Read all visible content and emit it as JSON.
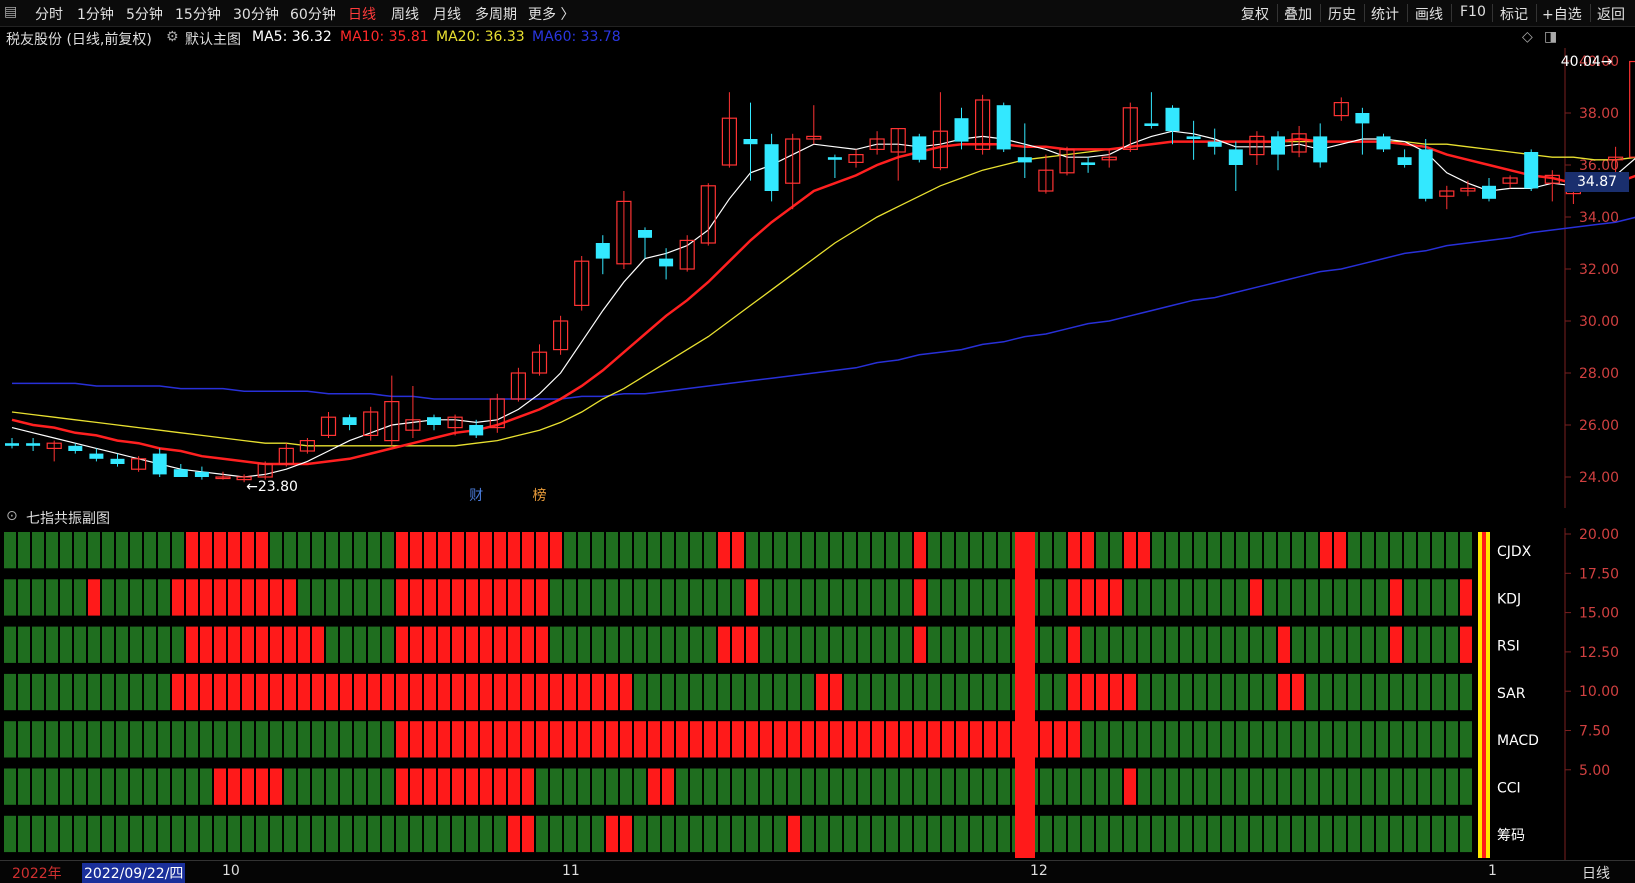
{
  "toolbar": {
    "left_tabs": [
      "分时",
      "1分钟",
      "5分钟",
      "15分钟",
      "30分钟",
      "60分钟",
      "日线",
      "周线",
      "月线",
      "多周期",
      "更多 〉"
    ],
    "active_tab": "日线",
    "right_tabs": [
      "复权",
      "叠加",
      "历史",
      "统计",
      "画线",
      "F10",
      "标记",
      "+自选",
      "返回"
    ]
  },
  "info": {
    "stock": "税友股份 (日线,前复权)",
    "main_chart": "默认主图",
    "ma5": "MA5: 36.32",
    "ma10": "MA10: 35.81",
    "ma20": "MA20: 36.33",
    "ma60": "MA60: 33.78"
  },
  "colors": {
    "up": "#ff3333",
    "down": "#33e8ff",
    "ma5": "#ffffff",
    "ma10": "#ff2020",
    "ma20": "#e8e030",
    "ma60": "#2830d8",
    "resonance_on": "#ff1a1a",
    "resonance_off": "#1f6e1f"
  },
  "price_axis": [
    "40.00",
    "38.00",
    "36.00",
    "34.00",
    "32.00",
    "30.00",
    "28.00",
    "26.00",
    "24.00"
  ],
  "current_price": "34.87",
  "high_label": "40.04",
  "low_label": "←23.80",
  "markers": [
    "财",
    "榜"
  ],
  "sub": {
    "title": "七指共振副图",
    "axis": [
      "20.00",
      "17.50",
      "15.00",
      "12.50",
      "10.00",
      "7.50",
      "5.00"
    ],
    "rows": [
      "CJDX",
      "KDJ",
      "RSI",
      "SAR",
      "MACD",
      "CCI",
      "筹码"
    ]
  },
  "bottom": {
    "year": "2022年",
    "date": "2022/09/22/四",
    "months": [
      "10",
      "11",
      "12",
      "1"
    ],
    "period": "日线"
  },
  "chart_data": {
    "type": "candlestick",
    "ylim": [
      23,
      40.5
    ],
    "ohlc": [
      [
        25.3,
        25.5,
        25.1,
        25.2
      ],
      [
        25.3,
        25.5,
        25.0,
        25.2
      ],
      [
        25.1,
        25.4,
        24.6,
        25.3
      ],
      [
        25.2,
        25.3,
        24.9,
        25.0
      ],
      [
        24.9,
        25.1,
        24.6,
        24.7
      ],
      [
        24.7,
        24.9,
        24.4,
        24.5
      ],
      [
        24.3,
        24.8,
        24.2,
        24.7
      ],
      [
        24.9,
        25.1,
        24.0,
        24.1
      ],
      [
        24.3,
        24.5,
        24.0,
        24.0
      ],
      [
        24.2,
        24.4,
        23.9,
        24.0
      ],
      [
        24.0,
        24.2,
        23.9,
        24.0
      ],
      [
        23.9,
        24.1,
        23.8,
        24.0
      ],
      [
        24.0,
        24.6,
        23.9,
        24.5
      ],
      [
        24.5,
        25.3,
        24.4,
        25.1
      ],
      [
        25.0,
        25.5,
        24.9,
        25.4
      ],
      [
        25.6,
        26.5,
        25.5,
        26.3
      ],
      [
        26.3,
        26.4,
        25.8,
        26.0
      ],
      [
        25.6,
        26.7,
        25.4,
        26.5
      ],
      [
        25.4,
        27.9,
        25.2,
        26.9
      ],
      [
        25.8,
        27.5,
        25.5,
        26.2
      ],
      [
        26.3,
        26.4,
        25.8,
        26.0
      ],
      [
        25.9,
        26.4,
        25.6,
        26.3
      ],
      [
        26.0,
        26.2,
        25.5,
        25.6
      ],
      [
        25.9,
        27.2,
        25.7,
        27.0
      ],
      [
        27.0,
        28.2,
        26.9,
        28.0
      ],
      [
        28.0,
        29.1,
        27.9,
        28.8
      ],
      [
        28.9,
        30.2,
        28.7,
        30.0
      ],
      [
        30.6,
        32.5,
        30.4,
        32.3
      ],
      [
        33.0,
        33.3,
        31.8,
        32.4
      ],
      [
        32.2,
        35.0,
        32.0,
        34.6
      ],
      [
        33.5,
        33.6,
        32.4,
        33.2
      ],
      [
        32.4,
        32.8,
        31.6,
        32.1
      ],
      [
        32.0,
        33.3,
        31.9,
        33.1
      ],
      [
        33.0,
        35.3,
        32.9,
        35.2
      ],
      [
        36.0,
        38.8,
        35.9,
        37.8
      ],
      [
        37.0,
        38.4,
        35.4,
        36.8
      ],
      [
        36.8,
        37.2,
        34.6,
        35.0
      ],
      [
        35.3,
        37.2,
        34.3,
        37.0
      ],
      [
        37.0,
        38.3,
        36.8,
        37.1
      ],
      [
        36.3,
        36.4,
        35.5,
        36.2
      ],
      [
        36.1,
        36.6,
        35.9,
        36.4
      ],
      [
        36.6,
        37.3,
        36.4,
        37.0
      ],
      [
        36.5,
        37.4,
        35.4,
        37.4
      ],
      [
        37.1,
        37.2,
        36.1,
        36.2
      ],
      [
        35.9,
        38.8,
        35.8,
        37.3
      ],
      [
        37.8,
        38.2,
        36.6,
        36.9
      ],
      [
        36.6,
        38.7,
        36.4,
        38.5
      ],
      [
        38.3,
        38.4,
        36.5,
        36.6
      ],
      [
        36.3,
        37.6,
        35.5,
        36.1
      ],
      [
        35.0,
        36.4,
        34.9,
        35.8
      ],
      [
        35.7,
        36.7,
        35.6,
        36.6
      ],
      [
        36.1,
        36.3,
        35.7,
        36.0
      ],
      [
        36.2,
        36.6,
        35.9,
        36.3
      ],
      [
        36.6,
        38.4,
        36.5,
        38.2
      ],
      [
        37.6,
        38.8,
        37.4,
        37.5
      ],
      [
        38.2,
        38.3,
        36.8,
        37.3
      ],
      [
        37.1,
        37.7,
        36.2,
        37.0
      ],
      [
        36.9,
        37.4,
        36.4,
        36.7
      ],
      [
        36.6,
        36.9,
        35.0,
        36.0
      ],
      [
        36.4,
        37.3,
        36.0,
        37.1
      ],
      [
        37.1,
        37.3,
        35.8,
        36.4
      ],
      [
        36.5,
        37.5,
        36.3,
        37.2
      ],
      [
        37.1,
        37.6,
        35.9,
        36.1
      ],
      [
        37.9,
        38.6,
        37.7,
        38.4
      ],
      [
        38.0,
        38.2,
        36.4,
        37.6
      ],
      [
        37.1,
        37.2,
        36.5,
        36.6
      ],
      [
        36.3,
        36.6,
        35.9,
        36.0
      ],
      [
        36.6,
        37.0,
        34.6,
        34.7
      ],
      [
        34.8,
        35.2,
        34.3,
        35.0
      ],
      [
        35.0,
        35.4,
        34.8,
        35.1
      ],
      [
        35.2,
        35.5,
        34.6,
        34.7
      ],
      [
        35.3,
        35.6,
        35.1,
        35.5
      ],
      [
        36.5,
        36.6,
        35.0,
        35.1
      ],
      [
        35.3,
        35.8,
        34.6,
        35.6
      ],
      [
        34.9,
        35.1,
        34.5,
        35.0
      ],
      [
        35.2,
        35.4,
        35.0,
        35.3
      ],
      [
        36.2,
        36.7,
        35.2,
        36.3
      ],
      [
        36.3,
        40.04,
        35.9,
        39.98
      ]
    ],
    "ma5": [
      25.9,
      25.7,
      25.5,
      25.3,
      25.1,
      24.9,
      24.7,
      24.5,
      24.3,
      24.2,
      24.1,
      24.0,
      24.1,
      24.3,
      24.6,
      25.0,
      25.4,
      25.7,
      26.0,
      26.1,
      26.2,
      26.2,
      26.1,
      26.2,
      26.6,
      27.2,
      28.0,
      29.2,
      30.4,
      31.5,
      32.4,
      32.6,
      32.9,
      33.5,
      34.7,
      35.7,
      36.0,
      36.4,
      36.8,
      36.7,
      36.6,
      36.8,
      36.8,
      36.7,
      36.8,
      37.0,
      37.1,
      37.0,
      36.8,
      36.6,
      36.3,
      36.3,
      36.4,
      36.8,
      37.1,
      37.3,
      37.2,
      37.0,
      36.7,
      36.7,
      36.7,
      36.8,
      36.6,
      36.8,
      37.0,
      37.0,
      36.9,
      36.5,
      35.7,
      35.3,
      35.0,
      35.1,
      35.1,
      35.3,
      35.2,
      35.3,
      35.6,
      36.3
    ],
    "ma10": [
      26.2,
      26.0,
      25.9,
      25.7,
      25.6,
      25.4,
      25.3,
      25.1,
      25.0,
      24.8,
      24.7,
      24.6,
      24.5,
      24.5,
      24.5,
      24.6,
      24.7,
      24.9,
      25.1,
      25.3,
      25.5,
      25.7,
      25.8,
      26.0,
      26.3,
      26.6,
      27.0,
      27.5,
      28.1,
      28.8,
      29.5,
      30.2,
      30.8,
      31.5,
      32.3,
      33.1,
      33.8,
      34.4,
      35.0,
      35.3,
      35.6,
      36.0,
      36.3,
      36.5,
      36.7,
      36.8,
      36.8,
      36.8,
      36.7,
      36.7,
      36.6,
      36.6,
      36.6,
      36.7,
      36.8,
      36.9,
      36.9,
      36.9,
      36.9,
      36.9,
      36.9,
      37.0,
      36.9,
      36.9,
      36.9,
      36.9,
      36.8,
      36.7,
      36.4,
      36.2,
      36.0,
      35.8,
      35.6,
      35.5,
      35.3,
      35.2,
      35.3,
      35.6
    ],
    "ma20": [
      26.5,
      26.4,
      26.3,
      26.2,
      26.1,
      26.0,
      25.9,
      25.8,
      25.7,
      25.6,
      25.5,
      25.4,
      25.3,
      25.3,
      25.2,
      25.2,
      25.2,
      25.2,
      25.2,
      25.2,
      25.2,
      25.2,
      25.3,
      25.4,
      25.6,
      25.8,
      26.1,
      26.5,
      27.0,
      27.4,
      27.9,
      28.4,
      28.9,
      29.4,
      30.0,
      30.6,
      31.2,
      31.8,
      32.4,
      33.0,
      33.5,
      34.0,
      34.4,
      34.8,
      35.2,
      35.5,
      35.8,
      36.0,
      36.2,
      36.3,
      36.4,
      36.5,
      36.6,
      36.7,
      36.8,
      36.9,
      36.9,
      36.9,
      36.9,
      36.9,
      36.9,
      36.9,
      36.9,
      36.9,
      36.9,
      36.9,
      36.9,
      36.8,
      36.8,
      36.7,
      36.6,
      36.5,
      36.4,
      36.3,
      36.3,
      36.2,
      36.2,
      36.3
    ],
    "ma60": [
      27.6,
      27.6,
      27.6,
      27.6,
      27.5,
      27.5,
      27.5,
      27.5,
      27.4,
      27.4,
      27.4,
      27.3,
      27.3,
      27.3,
      27.3,
      27.2,
      27.2,
      27.2,
      27.1,
      27.1,
      27.0,
      27.0,
      27.0,
      27.0,
      27.0,
      27.0,
      27.0,
      27.1,
      27.1,
      27.2,
      27.2,
      27.3,
      27.4,
      27.5,
      27.6,
      27.7,
      27.8,
      27.9,
      28.0,
      28.1,
      28.2,
      28.4,
      28.5,
      28.7,
      28.8,
      28.9,
      29.1,
      29.2,
      29.4,
      29.5,
      29.7,
      29.9,
      30.0,
      30.2,
      30.4,
      30.6,
      30.8,
      30.9,
      31.1,
      31.3,
      31.5,
      31.7,
      31.9,
      32.0,
      32.2,
      32.4,
      32.6,
      32.7,
      32.9,
      33.0,
      33.1,
      33.2,
      33.4,
      33.5,
      33.6,
      33.7,
      33.8,
      34.0
    ],
    "resonance": [
      "000000000000011111100000000011111111111100000000000110000000000001000000000011001100000000000011000000000",
      "000000100000111111111000000011111111111000000000000001000000000001000000000011110000000001000000000100001",
      "000000000000011111111110000011111111111000000000000111000000000001000000000010000000000000010000000100001",
      "000000000000111111111111111111111111111111111000000000000011000000000000000011111000000000011000000000000",
      "000000000000000000000000000011111111111111111111111111111111111111111111111110000000000000000000000000000",
      "000000000000000111110000000011111111110000000011000000000000000000000000000000001000000000000000000000000",
      "000000000000000000000000000000000000110000011000000000001000000000000000000000000000000000000000000000000"
    ]
  }
}
